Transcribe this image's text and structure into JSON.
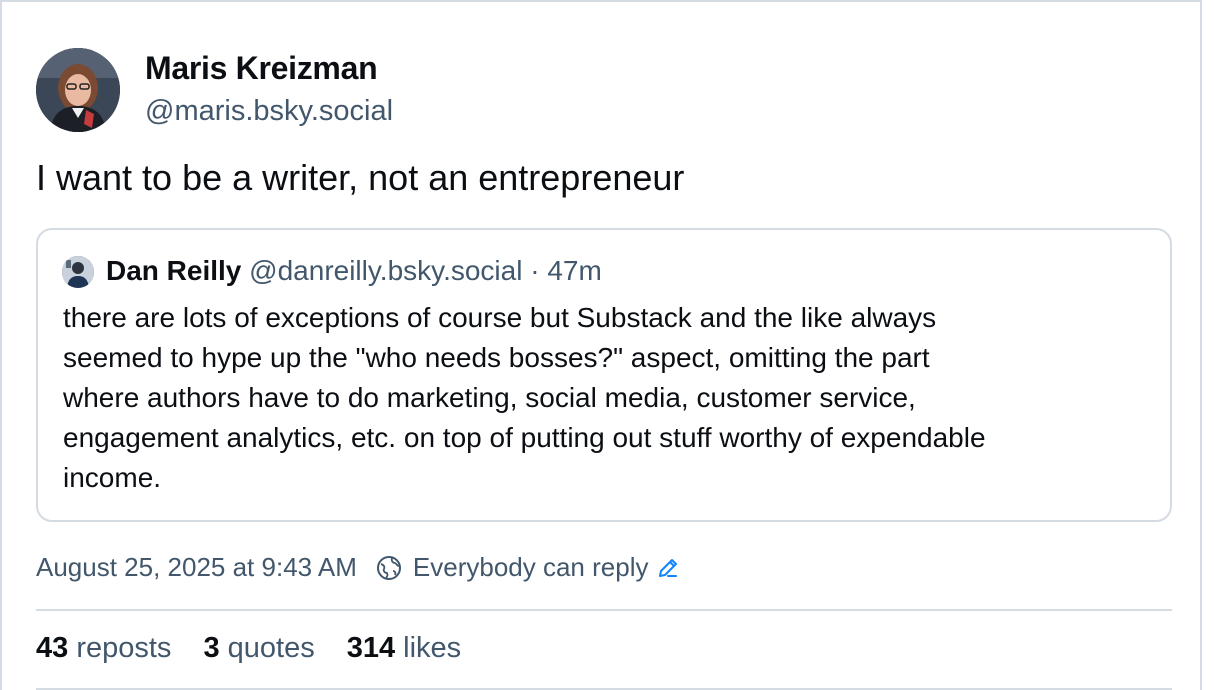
{
  "post": {
    "author": {
      "display_name": "Maris Kreizman",
      "handle": "@maris.bsky.social",
      "avatar_icon": "avatar-photo"
    },
    "text": "I want to be a writer, not an entrepreneur",
    "quoted_post": {
      "author_name": "Dan Reilly",
      "author_handle": "@danreilly.bsky.social",
      "separator": "·",
      "time_ago": "47m",
      "text": "there are lots of exceptions of course but Substack and the like always\nseemed to hype up the \"who needs bosses?\" aspect, omitting the part\nwhere authors have to do marketing, social media, customer service,\nengagement analytics, etc. on top of putting out stuff worthy of expendable\nincome."
    },
    "timestamp": "August 25, 2025 at 9:43 AM",
    "reply_setting": {
      "label": "Everybody can reply",
      "icon": "globe-icon",
      "edit_icon": "pencil-icon"
    },
    "stats": {
      "reposts_count": "43",
      "reposts_label": "reposts",
      "quotes_count": "3",
      "quotes_label": "quotes",
      "likes_count": "314",
      "likes_label": "likes"
    }
  },
  "colors": {
    "text_primary": "#0b0f14",
    "text_secondary": "#42576c",
    "border": "#d4dbe2",
    "accent": "#1083fe"
  }
}
